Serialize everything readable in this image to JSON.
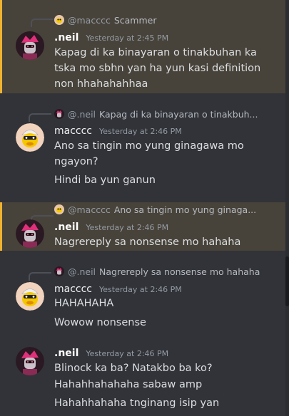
{
  "messages": [
    {
      "reply_name": "@macccc",
      "reply_text": "Scammer",
      "author": ".neil",
      "time": "Yesterday at 2:45 PM",
      "lines": [
        "Kapag di ka binayaran o tinakbuhan ka",
        "tska mo sbhn yan ha yun kasi definition",
        "non hhahahahhaa"
      ]
    },
    {
      "reply_name": "@.neil",
      "reply_text": "Kapag di ka binayaran o tinakbuh...",
      "author": "macccc",
      "time": "Yesterday at 2:46 PM",
      "lines": [
        "Ano sa tingin mo yung ginagawa mo",
        "ngayon?",
        "Hindi ba yun ganun"
      ]
    },
    {
      "reply_name": "@macccc",
      "reply_text": "Ano sa tingin mo yung ginaga...",
      "author": ".neil",
      "time": "Yesterday at 2:46 PM",
      "lines": [
        "Nagrereply sa nonsense mo hahaha"
      ]
    },
    {
      "reply_name": "@.neil",
      "reply_text": "Nagrereply sa nonsense mo hahaha",
      "author": "macccc",
      "time": "Yesterday at 2:46 PM",
      "lines": [
        "HAHAHAHA",
        "Wowow nonsense"
      ]
    },
    {
      "author": ".neil",
      "time": "Yesterday at 2:46 PM",
      "lines": [
        "Blinock ka ba? Natakbo ba ko?",
        "Hahahhahahaha sabaw amp",
        "Hahahhahaha tnginang isip yan"
      ]
    }
  ],
  "colors": {
    "background": "#313338",
    "highlight": "#48433a",
    "highlight_bar": "#f0b232"
  },
  "icons": {
    "neil_avatar": "robot-avatar-icon",
    "macccc_avatar": "duck-avatar-icon"
  }
}
